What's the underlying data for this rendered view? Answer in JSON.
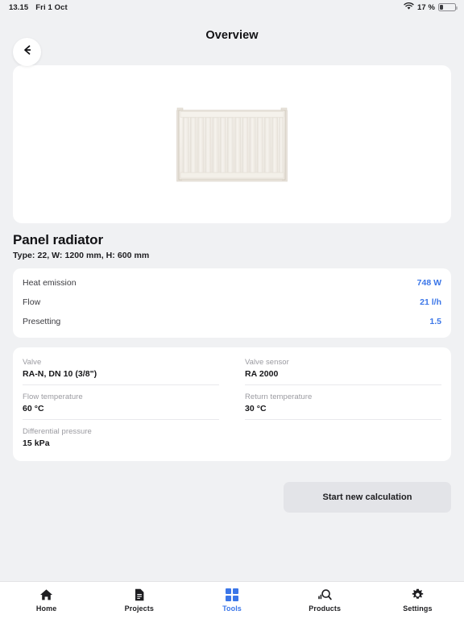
{
  "status_bar": {
    "time": "13.15",
    "date": "Fri 1 Oct",
    "wifi_icon": "wifi-icon",
    "battery_percent": "17 %",
    "battery_icon": "battery-icon"
  },
  "header": {
    "back_icon": "arrow-left-icon",
    "title": "Overview"
  },
  "image_card": {
    "product_image_name": "panel-radiator-image"
  },
  "product": {
    "name": "Panel radiator",
    "subtitle": "Type: 22, W: 1200 mm, H: 600 mm"
  },
  "metrics": [
    {
      "label": "Heat emission",
      "value": "748 W"
    },
    {
      "label": "Flow",
      "value": "21 l/h"
    },
    {
      "label": "Presetting",
      "value": "1.5"
    }
  ],
  "specs": [
    {
      "label": "Valve",
      "value": "RA-N, DN 10 (3/8\")"
    },
    {
      "label": "Valve sensor",
      "value": "RA 2000"
    },
    {
      "label": "Flow temperature",
      "value": "60 °C"
    },
    {
      "label": "Return temperature",
      "value": "30 °C"
    },
    {
      "label": "Differential pressure",
      "value": "15 kPa"
    }
  ],
  "actions": {
    "start_new_calculation": "Start new calculation"
  },
  "tabbar": {
    "items": [
      {
        "label": "Home",
        "icon": "home-icon",
        "active": false
      },
      {
        "label": "Projects",
        "icon": "document-icon",
        "active": false
      },
      {
        "label": "Tools",
        "icon": "grid-squares-icon",
        "active": true
      },
      {
        "label": "Products",
        "icon": "search-product-icon",
        "active": false
      },
      {
        "label": "Settings",
        "icon": "gear-icon",
        "active": false
      }
    ]
  },
  "colors": {
    "accent": "#3b76e8",
    "page_background": "#f0f1f3",
    "card_background": "#ffffff",
    "button_background": "#e3e4e8"
  }
}
